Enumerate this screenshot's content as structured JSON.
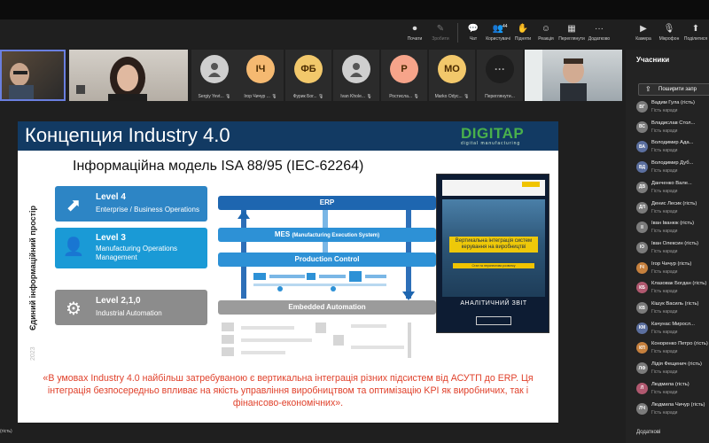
{
  "toolbar": {
    "items": [
      {
        "label": "Почати",
        "icon": "record-icon"
      },
      {
        "label": "Зробити",
        "icon": "ai-icon"
      },
      {
        "label": "Чат",
        "icon": "chat-icon"
      },
      {
        "label": "Користувачі",
        "icon": "people-icon",
        "badge": "44"
      },
      {
        "label": "Підняти",
        "icon": "hand-icon"
      },
      {
        "label": "Реакція",
        "icon": "smile-icon"
      },
      {
        "label": "Переглянути",
        "icon": "view-icon"
      },
      {
        "label": "Додатково",
        "icon": "more-icon"
      }
    ],
    "device_items": [
      {
        "label": "Камера",
        "icon": "camera-icon"
      },
      {
        "label": "Мікрофон",
        "icon": "mic-icon"
      },
      {
        "label": "Поділитися",
        "icon": "share-icon"
      }
    ]
  },
  "tiles": [
    {
      "kind": "video",
      "name": ""
    },
    {
      "kind": "video",
      "name": ""
    },
    {
      "kind": "avatar",
      "initials": "",
      "color": "#cfcfcf",
      "name": "Sergiy Yevt..."
    },
    {
      "kind": "avatar",
      "initials": "ІЧ",
      "color": "#f5b971",
      "name": "Ігор Чичур ..."
    },
    {
      "kind": "avatar",
      "initials": "ФБ",
      "color": "#f2c86b",
      "name": "Фурик Бог..."
    },
    {
      "kind": "avatar",
      "initials": "",
      "color": "#cfcfcf",
      "name": "Ivan Khole..."
    },
    {
      "kind": "avatar",
      "initials": "Р",
      "color": "#f6a48a",
      "name": "Ростисла..."
    },
    {
      "kind": "avatar",
      "initials": "МО",
      "color": "#f2c86b",
      "name": "Marko Odyc..."
    },
    {
      "kind": "more",
      "initials": "···",
      "name": "Переглянути..."
    },
    {
      "kind": "video",
      "name": ""
    }
  ],
  "slide": {
    "title": "Концепция Industry 4.0",
    "logo": "DIGITAP",
    "logo_sub": "digital manufacturing",
    "subtitle": "Інформаційна модель ISA 88/95 (IEC-62264)",
    "vertical_label": "Єдиний інформаційний простір",
    "year": "2023",
    "levels": [
      {
        "t1": "Level 4",
        "t2": "Enterprise / Business Operations",
        "icon": "chart-user-icon"
      },
      {
        "t1": "Level 3",
        "t2": "Manufacturing Operations Management",
        "icon": "manager-icon"
      },
      {
        "t1": "Level 2,1,0",
        "t2": "Industrial Automation",
        "icon": "gear-icon"
      }
    ],
    "bars": {
      "erp": "ERP",
      "mes_main": "MES",
      "mes_detail": "(Manufacturing Execution System)",
      "pc": "Production Control",
      "ea": "Embedded Automation"
    },
    "book": {
      "title": "Вертикальна інтеграція систем керування на виробництві",
      "sub": "Стан та перспективи розвитку",
      "report": "АНАЛІТИЧНИЙ ЗВІТ"
    },
    "quote": "«В умовах Industry 4.0 найбільш затребуваною є вертикальна інтеграція різних підсистем від АСУТП до ERP. Ця інтеграція безпосередньо впливає на якість управління виробництвом та оптимізацію KPI як виробничих, так і фінансово-економічних»."
  },
  "panel": {
    "title": "Учасники",
    "invite": "Поширити запр",
    "people": [
      {
        "initials": "ВГ",
        "color": "#7b7b7b",
        "name": "Вадим Гула (гість)",
        "role": "Гість наради"
      },
      {
        "initials": "ВС",
        "color": "#7b7b7b",
        "name": "Владислав Стол...",
        "role": "Гість наради"
      },
      {
        "initials": "ВА",
        "color": "#5b6f9f",
        "name": "Володимир Ада...",
        "role": "Гість наради"
      },
      {
        "initials": "ВД",
        "color": "#5b6f9f",
        "name": "Володимир Дуб...",
        "role": "Гість наради"
      },
      {
        "initials": "ДВ",
        "color": "#7b7b7b",
        "name": "Данченко Вале...",
        "role": "Гість наради"
      },
      {
        "initials": "ДЛ",
        "color": "#7b7b7b",
        "name": "Денис Лесик (гість)",
        "role": "Гість наради"
      },
      {
        "initials": "ІІ",
        "color": "#7b7b7b",
        "name": "Іван Іванюк (гість)",
        "role": "Гість наради"
      },
      {
        "initials": "ІО",
        "color": "#7b7b7b",
        "name": "Іван Олексин (гість)",
        "role": "Гість наради"
      },
      {
        "initials": "ІЧ",
        "color": "#c6803d",
        "name": "Ігор Чичур (гість)",
        "role": "Гість наради"
      },
      {
        "initials": "КБ",
        "color": "#b0586f",
        "name": "Клазовак Богдан (гість)",
        "role": "Гість наради"
      },
      {
        "initials": "КВ",
        "color": "#7b7b7b",
        "name": "Кішук Василь (гість)",
        "role": "Гість наради"
      },
      {
        "initials": "КМ",
        "color": "#5b6f9f",
        "name": "Качунас Миросл...",
        "role": "Гість наради"
      },
      {
        "initials": "КП",
        "color": "#c6803d",
        "name": "Коноренко Петро (гість)",
        "role": "Гість наради"
      },
      {
        "initials": "ЛФ",
        "color": "#7b7b7b",
        "name": "Лідія Фещенич (гість)",
        "role": "Гість наради"
      },
      {
        "initials": "Л",
        "color": "#b0586f",
        "name": "Людмила (гість)",
        "role": "Гість наради"
      },
      {
        "initials": "ЛЧ",
        "color": "#7b7b7b",
        "name": "Людмила Чичур (гість)",
        "role": "Гість наради"
      }
    ],
    "footer": "Додаткові"
  },
  "bottom_text": "(гість)"
}
